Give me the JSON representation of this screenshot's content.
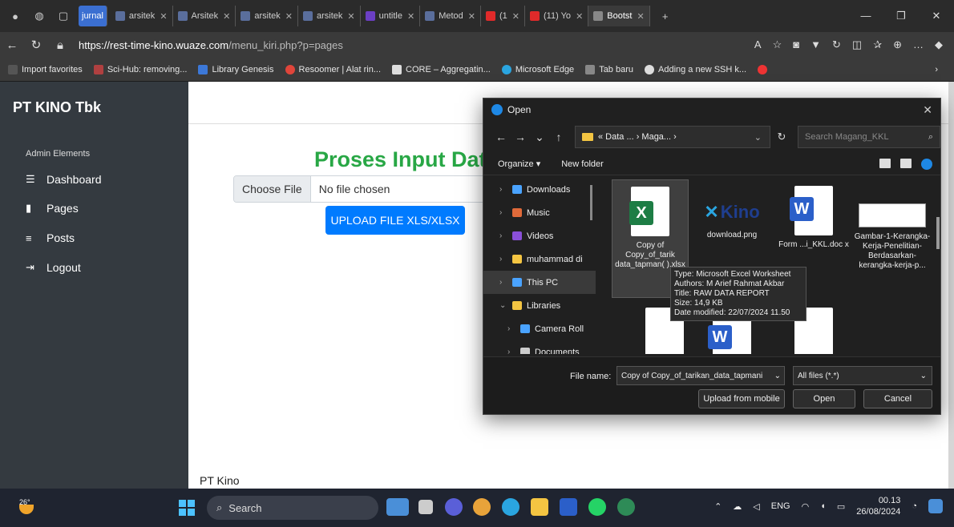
{
  "browser": {
    "tab_group": "jurnal",
    "tabs": [
      {
        "label": "arsitek",
        "color": "#5a6e9c"
      },
      {
        "label": "Arsitek",
        "color": "#5a6e9c"
      },
      {
        "label": "arsitek",
        "color": "#5a6e9c"
      },
      {
        "label": "arsitek",
        "color": "#5a6e9c"
      },
      {
        "label": "untitle",
        "color": "#6b3fc4"
      },
      {
        "label": "Metod",
        "color": "#5a6e9c"
      },
      {
        "label": "(1",
        "color": "#e02a2a"
      },
      {
        "label": "(11) Yo",
        "color": "#e02a2a"
      },
      {
        "label": "Bootst",
        "color": "#888888"
      }
    ],
    "url_host": "https://rest-time-kino.wuaze.com",
    "url_path": "/menu_kiri.php?p=pages",
    "favorites": [
      {
        "label": "Import favorites",
        "color": "#555555"
      },
      {
        "label": "Sci-Hub: removing...",
        "color": "#b04040"
      },
      {
        "label": "Library Genesis",
        "color": "#3c78d8"
      },
      {
        "label": "Resoomer | Alat rin...",
        "color": "#e0453a"
      },
      {
        "label": "CORE – Aggregatin...",
        "color": "#dddddd"
      },
      {
        "label": "Microsoft Edge",
        "color": "#2aa5e0"
      },
      {
        "label": "Tab baru",
        "color": "#888888"
      },
      {
        "label": "Adding a new SSH k...",
        "color": "#dddddd"
      }
    ]
  },
  "sidebar": {
    "brand": "PT KINO Tbk",
    "heading": "Admin Elements",
    "items": [
      {
        "label": "Dashboard",
        "icon": "☰"
      },
      {
        "label": "Pages",
        "icon": "▮"
      },
      {
        "label": "Posts",
        "icon": "≡"
      },
      {
        "label": "Logout",
        "icon": "⇥"
      }
    ]
  },
  "main": {
    "title": "Proses Input Data",
    "choose_file": "Choose File",
    "no_file": "No file chosen",
    "upload_button": "UPLOAD FILE XLS/XLSX",
    "footer": "PT Kino"
  },
  "dialog": {
    "title": "Open",
    "breadcrumb": "« Data ... › Maga... ›",
    "search_placeholder": "Search Magang_KKL",
    "organize": "Organize ▾",
    "new_folder": "New folder",
    "tree": [
      {
        "label": "Downloads",
        "color": "#4aa3ff"
      },
      {
        "label": "Music",
        "color": "#e06a3a"
      },
      {
        "label": "Videos",
        "color": "#8a4fd8"
      },
      {
        "label": "muhammad di",
        "color": "#f4c542"
      },
      {
        "label": "This PC",
        "color": "#4aa3ff"
      },
      {
        "label": "Libraries",
        "color": "#f4c542"
      },
      {
        "label": "Camera Roll",
        "color": "#4aa3ff"
      },
      {
        "label": "Documents",
        "color": "#cccccc"
      }
    ],
    "files": [
      {
        "name": "Copy of Copy_of_tarik data_tapman( ).xlsx",
        "type": "excel"
      },
      {
        "name": "download.png",
        "type": "image"
      },
      {
        "name": "Form ...i_KKL.doc x",
        "type": "word"
      },
      {
        "name": "Gambar-1-Kerangka-Kerja-Penelitian-Berdasarkan-kerangka-kerja-p...",
        "type": "diagram"
      }
    ],
    "tooltip": {
      "type": "Type: Microsoft Excel Worksheet",
      "authors": "Authors: M Arief Rahmat Akbar",
      "title": "Title: RAW DATA REPORT",
      "size": "Size: 14,9 KB",
      "modified": "Date modified: 22/07/2024 11.50"
    },
    "filename_label": "File name:",
    "filename_value": "Copy of Copy_of_tarikan_data_tapmani",
    "filetype_value": "All files (*.*)",
    "upload_mobile": "Upload from mobile",
    "open": "Open",
    "cancel": "Cancel"
  },
  "taskbar": {
    "weather": "26°",
    "search": "Search",
    "lang": "ENG",
    "time": "00.13",
    "date": "26/08/2024"
  }
}
